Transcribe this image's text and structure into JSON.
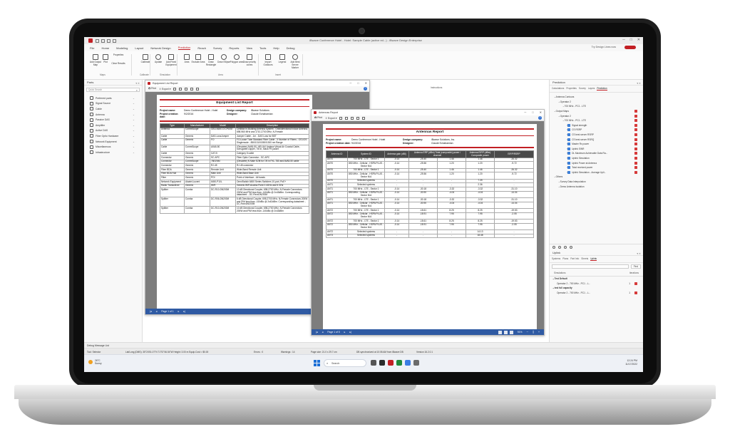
{
  "app": {
    "title": "iBwave Conference Hotel - Hotel: Sample Cable (active ed...) - iBwave Design Enterprise",
    "menu": [
      "File",
      "Home",
      "Modeling",
      "Layout",
      "Network Design",
      "Prediction",
      "Reach",
      "Survey",
      "Reports",
      "View",
      "Tools",
      "Help",
      "Debug"
    ],
    "active_menu": "Prediction",
    "design_lines": "Try Design Lines now",
    "accent": "#c21f24"
  },
  "ribbon": {
    "buttons": [
      "Add Output Map",
      "Plot",
      "Properties",
      "Clear Results",
      "Calibrate",
      "Update",
      "Add Fixed Equipment",
      "Area",
      "Exclude Area",
      "Draw Rectangle",
      "Draw Ellipse",
      "Polygon area",
      "Draw priority zones",
      "Import Outdoors",
      "Legend",
      "Add Best Server Marker"
    ],
    "groups": [
      "Maps",
      "Calibrate",
      "Simulation",
      "Area",
      "Insert"
    ]
  },
  "parts": {
    "title": "Parts",
    "search_placeholder": "Quick Search",
    "items": [
      "Preferred parts",
      "Signal Source",
      "Cable",
      "Antenna",
      "Passive DAS",
      "Amplifier",
      "Active DAS",
      "Fiber Optic Hardware",
      "Network Equipment",
      "Miscellaneous",
      "Infrastructure"
    ]
  },
  "canvas": {
    "edit_label": "Instructions"
  },
  "equipment_report": {
    "window_title": "Equipment List Report",
    "toolbar": {
      "print": "Print",
      "export": "Export"
    },
    "report_title": "Equipment List Report",
    "meta": {
      "project_name_label": "Project name:",
      "project_name": "Demo Conference Hotel - Hotel",
      "design_company_label": "Design company:",
      "design_company": "iBwave Solutions",
      "creation_date_label": "Project creation date:",
      "creation_date": "9/2/2016",
      "designer_label": "Designer:",
      "designer": "Claude Echahamian"
    },
    "columns": [
      "Type",
      "Manufacturer",
      "Model",
      "Description"
    ],
    "rows": [
      [
        "Antenna",
        "CommScope",
        "CELLMAX-O-CPUSE",
        "CellMax In-Building Antenna System - Omnidirectional Indoor Antenna, 698-960 MHz and 1710-2700 MHz, N-Female"
      ],
      [
        "Cable",
        "Generic",
        "DAS-LossJumper",
        "Jumper Cable - 1m - DAS Loss for BST"
      ],
      [
        "Cable",
        "Generic",
        "FO",
        "FO-Loose Tube Standard Fiber Cable - X Number of Fibers - OS1/OS Singlemode - 850/1310/1550/1300 nm Range"
      ],
      [
        "Cable",
        "CommScope",
        "AVA5-50",
        "(Obsolete) AVA5-50, HELIAX Andrew Virtual Air Coaxial Cable, corrugated copper, 7/8 in, black PE jacket"
      ],
      [
        "Cable",
        "Generic",
        "CAT-5",
        "Category 5 cable"
      ],
      [
        "Connector",
        "Generic",
        "SC-APC",
        "Fiber Optic Connector - SC-APC"
      ],
      [
        "Connector",
        "CommScope",
        "78EZNM",
        "(Obsolete) N Male EZfit for 7/8 in FXL-780 and AVA5-50 cable"
      ],
      [
        "Connector",
        "Generic",
        "RJ-45",
        "RJ-45 connector"
      ],
      [
        "Fiber BDA",
        "Generic",
        "Remote Unit",
        "Wide-Band Remote Unit"
      ],
      [
        "Fiber BDA Hub",
        "Generic",
        "Main Unit",
        "Wide-Band Base Unit"
      ],
      [
        "Filter",
        "Generic",
        "POI",
        "Point of Interface - All bands"
      ],
      [
        "Network Equipment",
        "Alcatel-Lucent",
        "6450-P10L",
        "OmniSwitch 6450 Series Switches 10-port, PoE+"
      ],
      [
        "Radio Transceiver",
        "Generic",
        "WiFi",
        "Generic WiFi Access Point 2.4GHz and 5 GHz"
      ],
      [
        "Splitter",
        "Comba",
        "DC-R10-DN200M",
        "10 dB Directional Coupler, 698-2700 MHz, N-Female Connectors 200W and PIM less than -140dBc @ 2x43dBm. Corresponding datasheet: - DC-RxxxDN200M"
      ],
      [
        "Splitter",
        "Comba",
        "DC-R06-DN200M",
        "6 dB Directional Coupler, 698-2700 MHz, N-Female Connectors 200W and PIM less than -140dBc @ 2x43dBm. Corresponding datasheet: - DC-RxxxDN200M"
      ],
      [
        "Splitter",
        "Comba",
        "DC-R10-DN200M",
        "10 dB Directional Coupler, 698-2700 MHz, N-Female Connectors 200W and PIM less than -140dBc @ 2x43dBm"
      ]
    ],
    "page_label": "Page 1 of 1"
  },
  "antennas_report": {
    "window_title": "Antennas Report",
    "toolbar": {
      "print": "Print",
      "export": "Export"
    },
    "report_title": "Antennas Report",
    "meta": {
      "project_name_label": "Project name:",
      "project_name": "Demo Conference Hotel - Hotel",
      "design_company_label": "Design company:",
      "design_company": "iBwave Solutions, Inc.",
      "creation_date_label": "Project creation date:",
      "creation_date": "9/2/2016",
      "designer_label": "Designer:",
      "designer": "Claude Echahamian"
    },
    "columns": [
      "Antenna ID",
      "System ID",
      "Antenna gain (dBi)",
      "Antenna ERP (dBm) Total (composite) power / channel",
      "Antenna EIRP (dBm) Composite power",
      "EIRP/RSRP"
    ],
    "rows": [
      [
        "ANT0",
        "700 MHz - LTE - Sector 1",
        "-0.14",
        "-25.40",
        "1.46",
        "1.46",
        "-26.32"
      ],
      [
        "ANT0",
        "850 MHz - Cellular - HSPA PLUS - Sector N/A",
        "-0.14",
        "-25.56",
        "1.20",
        "1.20",
        "-9.72"
      ],
      [
        "ANT0",
        "700 MHz - LTE - Sector 1",
        "-0.14",
        "-25.40",
        "1.46",
        "1.46",
        "-26.32"
      ],
      [
        "ANT0",
        "850 MHz - Cellular - HSPA PLUS - Sector N/A",
        "-0.14",
        "-25.56",
        "1.20",
        "1.20",
        "-9.72"
      ],
      [
        "ANT0",
        "Selected systems",
        "-",
        "-",
        "-",
        "7.39",
        "-"
      ],
      [
        "ANT1",
        "Selected systems",
        "-",
        "-",
        "-",
        "2.36",
        "-"
      ],
      [
        "ANT1",
        "700 MHz - LTE - Sector 1",
        "-0.14",
        "-30.18",
        "-3.32",
        "-3.32",
        "-31.10"
      ],
      [
        "ANT1",
        "850 MHz - Cellular - HSPA PLUS - Sector N/A",
        "-0.14",
        "-30.90",
        "-4.04",
        "-4.04",
        "-14.04"
      ],
      [
        "ANT1",
        "700 MHz - LTE - Sector 1",
        "-0.14",
        "-30.18",
        "-3.32",
        "-3.32",
        "-31.10"
      ],
      [
        "ANT1",
        "850 MHz - Cellular - HSPA PLUS - Sector N/A",
        "-0.14",
        "-30.90",
        "-4.04",
        "-4.04",
        "-14.04"
      ],
      [
        "ANT2",
        "700 MHz - LTE - Sector 1",
        "-0.14",
        "-18.61",
        "8.25",
        "8.25",
        "-19.53"
      ],
      [
        "ANT2",
        "850 MHz - Cellular - HSPA PLUS - Sector N/A",
        "-0.14",
        "-18.91",
        "7.95",
        "7.95",
        "-2.05"
      ],
      [
        "ANT2",
        "700 MHz - LTE - Sector 1",
        "-0.14",
        "-18.61",
        "8.25",
        "8.25",
        "-19.53"
      ],
      [
        "ANT2",
        "850 MHz - Cellular - HSPA PLUS - Sector N/A",
        "-0.14",
        "-18.91",
        "7.95",
        "7.95",
        "-2.05"
      ],
      [
        "ANT2",
        "Selected systems",
        "-",
        "-",
        "-",
        "14.13",
        "-"
      ],
      [
        "ANT3",
        "Selected systems",
        "-",
        "-",
        "-",
        "18.48",
        "-"
      ]
    ],
    "page_label": "Page 1 of 5",
    "zoom": "91%"
  },
  "prediction": {
    "title": "Prediction",
    "tabs": [
      "Calculations",
      "Properties",
      "Survey",
      "Layers",
      "Prediction"
    ],
    "tree": [
      {
        "label": "Antenna Contours",
        "level": 0,
        "check": false
      },
      {
        "label": "Operator 2",
        "level": 1,
        "check": false
      },
      {
        "label": "700 MHz - PC1 - LTE",
        "level": 2,
        "check": false
      },
      {
        "label": "Output Maps",
        "level": 0,
        "check": true
      },
      {
        "label": "Operator 2",
        "level": 1,
        "check": true
      },
      {
        "label": "700 MHz - PC1 - LTE",
        "level": 2,
        "check": true
      },
      {
        "label": "Signal strength",
        "level": 3,
        "check": true
      },
      {
        "label": "CS RSRP",
        "level": 3,
        "check": true
      },
      {
        "label": "CS best server RSRP",
        "level": 3,
        "check": true
      },
      {
        "label": "CS best server RSRQ",
        "level": 3,
        "check": true
      },
      {
        "label": "Master Rx power",
        "level": 3,
        "check": true
      },
      {
        "label": "Uplink SINR",
        "level": 3,
        "check": true
      },
      {
        "label": "DL Maximum Achievable Data Ra...",
        "level": 3,
        "check": true
      },
      {
        "label": "Uplink Simulation",
        "level": 3,
        "check": true
      },
      {
        "label": "Uplink Power at Antenna",
        "level": 3,
        "check": true
      },
      {
        "label": "Total received power",
        "level": 3,
        "check": true
      },
      {
        "label": "Uplink Simulation - Average Upli...",
        "level": 3,
        "check": true
      },
      {
        "label": "Others",
        "level": 0,
        "check": false
      },
      {
        "label": "Survey Data Interpolation",
        "level": 1,
        "check": false
      },
      {
        "label": "Demo Antenna Isolation",
        "level": 1,
        "check": false
      }
    ]
  },
  "uplink": {
    "title": "Uplink",
    "tabs": [
      "Systems",
      "Plans",
      "Part Info",
      "Sheets",
      "Uplink"
    ],
    "find_label": "Find",
    "columns": [
      "Simulations",
      "Iterations"
    ],
    "rows": [
      {
        "label": "Test Default",
        "bold": true
      },
      {
        "label": "Operator 2 - 700 MHz - PC1 - L...",
        "value": "1",
        "check": true
      },
      {
        "label": "test full capacity",
        "bold": true
      },
      {
        "label": "Operator 2 - 700 MHz - PC1 - L...",
        "value": "1",
        "check": true
      }
    ]
  },
  "message_bar": "Debug Message List",
  "status_bar": {
    "tool": "Tool: Selector",
    "coords": "Lat/Long (DMS): 35°24'51.07\"N 71°57'46.54\"W Height: 3.00 m  Equip.Cost = $0.00",
    "errors": "Errors : 0",
    "warnings": "Warnings : 14",
    "page_size": "Page size: 21.0 x 29.7 cm",
    "db": "DB synchronized at 10:08 AM from iBwave DB",
    "version": "Version 16.2.0.1"
  },
  "taskbar": {
    "weather_temp": "26°C",
    "weather_desc": "Sunny",
    "search": "Search",
    "time": "12:24 PM",
    "date": "11/17/2022"
  }
}
